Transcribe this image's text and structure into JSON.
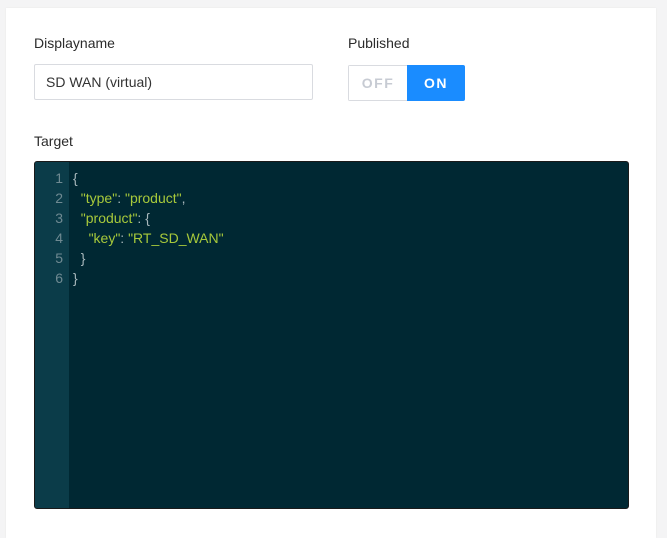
{
  "form": {
    "displayname_label": "Displayname",
    "displayname_value": "SD WAN (virtual)",
    "published_label": "Published",
    "published_off": "OFF",
    "published_on": "ON",
    "published_state": "ON",
    "target_label": "Target"
  },
  "editor": {
    "lines": [
      {
        "number": "1",
        "text": "{"
      },
      {
        "number": "2",
        "text": "  \"type\": \"product\","
      },
      {
        "number": "3",
        "text": "  \"product\": {"
      },
      {
        "number": "4",
        "text": "    \"key\": \"RT_SD_WAN\""
      },
      {
        "number": "5",
        "text": "  }"
      },
      {
        "number": "6",
        "text": "}"
      }
    ],
    "tokens": {
      "open_brace": "{",
      "close_brace": "}",
      "type_key": "\"type\"",
      "type_value": "\"product\"",
      "product_key": "\"product\"",
      "key_key": "\"key\"",
      "key_value": "\"RT_SD_WAN\"",
      "colon": ": ",
      "comma": ","
    }
  },
  "colors": {
    "accent": "#1a8cff",
    "editor_background": "#002833",
    "editor_gutter": "#0b3c49",
    "editor_string": "#a7c93b"
  }
}
